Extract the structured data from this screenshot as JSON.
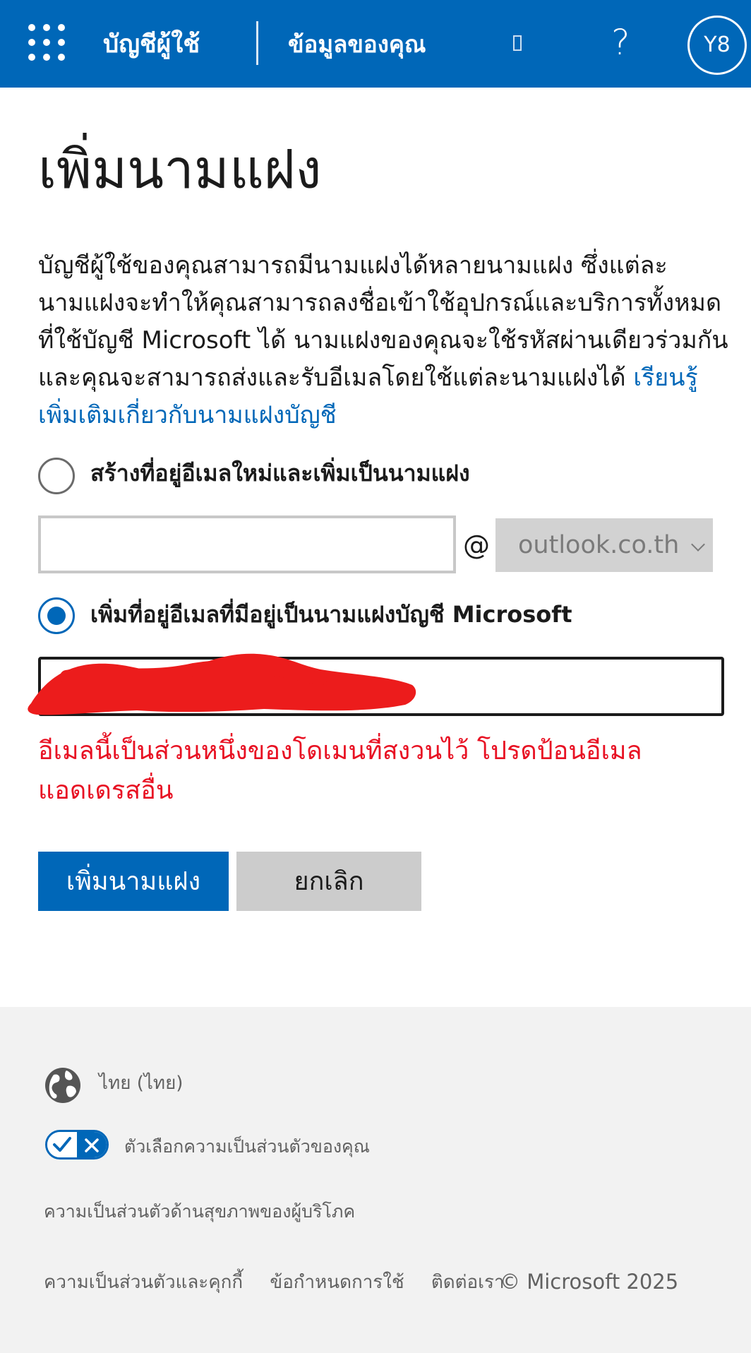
{
  "header": {
    "app_title": "บัญชีผู้ใช้",
    "section_title": "ข้อมูลของคุณ",
    "help_label": "?",
    "avatar_initials": "Y8",
    "brand_color": "#0067b8"
  },
  "main": {
    "page_title": "เพิ่มนามแฝง",
    "description": "บัญชีผู้ใช้ของคุณสามารถมีนามแฝงได้หลายนามแฝง ซึ่งแต่ละนามแฝงจะทำให้คุณสามารถลงชื่อเข้าใช้อุปกรณ์และบริการทั้งหมดที่ใช้บัญชี Microsoft ได้ นามแฝงของคุณจะใช้รหัสผ่านเดียวร่วมกันและคุณจะสามารถส่งและรับอีเมลโดยใช้แต่ละนามแฝงได้ ",
    "learn_more_link": "เรียนรู้เพิ่มเติมเกี่ยวกับนามแฝงบัญชี",
    "option_new": {
      "label": "สร้างที่อยู่อีเมลใหม่และเพิ่มเป็นนามแฝง",
      "selected": false,
      "input_value": "",
      "at_sign": "@",
      "domain": "outlook.co.th"
    },
    "option_existing": {
      "label": "เพิ่มที่อยู่อีเมลที่มีอยู่เป็นนามแฝงบัญชี Microsoft",
      "selected": true,
      "input_value": ""
    },
    "error_message": "อีเมลนี้เป็นส่วนหนึ่งของโดเมนที่สงวนไว้ โปรดป้อนอีเมลแอดเดรสอื่น",
    "error_color": "#e81123",
    "add_button": "เพิ่มนามแฝง",
    "cancel_button": "ยกเลิก"
  },
  "footer": {
    "language": "ไทย (ไทย)",
    "privacy_choices": "ตัวเลือกความเป็นส่วนตัวของคุณ",
    "consumer_health": "ความเป็นส่วนตัวด้านสุขภาพของผู้บริโภค",
    "links": [
      "ความเป็นส่วนตัวและคุกกี้",
      "ข้อกำหนดการใช้",
      "ติดต่อเรา"
    ],
    "copyright": "© Microsoft 2025"
  }
}
